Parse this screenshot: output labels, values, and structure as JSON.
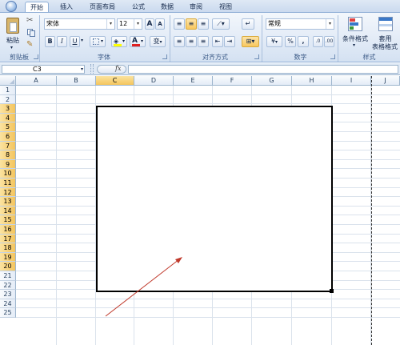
{
  "tabs": [
    {
      "label": "开始",
      "active": true
    },
    {
      "label": "插入",
      "active": false
    },
    {
      "label": "页面布局",
      "active": false
    },
    {
      "label": "公式",
      "active": false
    },
    {
      "label": "数据",
      "active": false
    },
    {
      "label": "审阅",
      "active": false
    },
    {
      "label": "视图",
      "active": false
    }
  ],
  "clipboard": {
    "paste_label": "粘贴",
    "group_label": "剪贴板"
  },
  "font": {
    "name": "宋体",
    "size": "12",
    "bold": "B",
    "italic": "I",
    "underline": "U",
    "font_color_glyph": "A",
    "phonetic_glyph": "变",
    "grow_glyph": "A",
    "shrink_glyph": "A",
    "group_label": "字体"
  },
  "alignment": {
    "group_label": "对齐方式"
  },
  "number": {
    "format": "常规",
    "currency_glyph": "¥",
    "percent_glyph": "%",
    "comma_glyph": ",",
    "group_label": "数字"
  },
  "styles": {
    "conditional_label": "条件格式",
    "table_label_1": "套用",
    "table_label_2": "表格格式",
    "group_label": "样式"
  },
  "formula_bar": {
    "name_box": "C3",
    "fx": "fx"
  },
  "columns": [
    "A",
    "B",
    "C",
    "D",
    "E",
    "F",
    "G",
    "H",
    "I",
    "J"
  ],
  "rows": [
    "1",
    "2",
    "3",
    "4",
    "5",
    "6",
    "7",
    "8",
    "9",
    "10",
    "11",
    "12",
    "13",
    "14",
    "15",
    "16",
    "17",
    "18",
    "19",
    "20",
    "21",
    "22",
    "23",
    "24",
    "25"
  ],
  "colors": {
    "accent": "#f4c55d",
    "arrow": "#c0392b",
    "header_blue": "#dfe9f5"
  }
}
